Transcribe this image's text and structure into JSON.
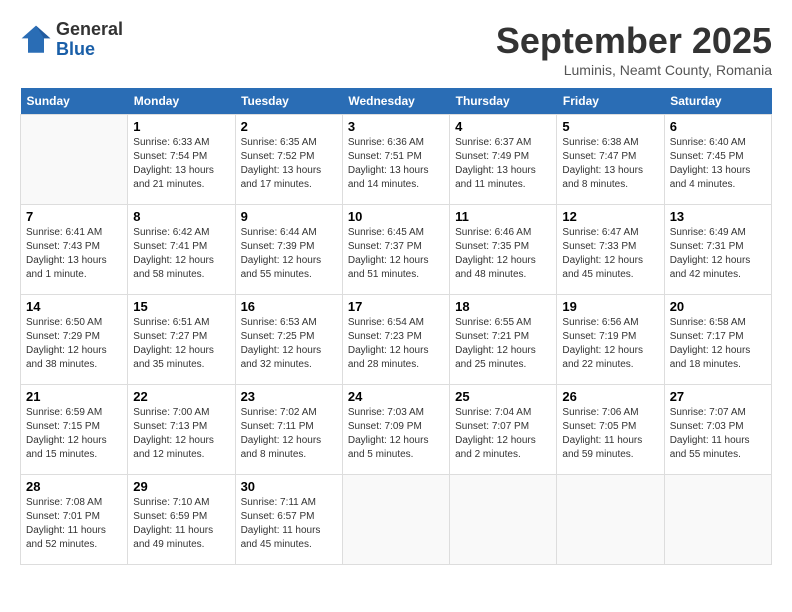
{
  "header": {
    "logo_general": "General",
    "logo_blue": "Blue",
    "month_title": "September 2025",
    "subtitle": "Luminis, Neamt County, Romania"
  },
  "days_of_week": [
    "Sunday",
    "Monday",
    "Tuesday",
    "Wednesday",
    "Thursday",
    "Friday",
    "Saturday"
  ],
  "weeks": [
    [
      {
        "day": "",
        "info": ""
      },
      {
        "day": "1",
        "info": "Sunrise: 6:33 AM\nSunset: 7:54 PM\nDaylight: 13 hours\nand 21 minutes."
      },
      {
        "day": "2",
        "info": "Sunrise: 6:35 AM\nSunset: 7:52 PM\nDaylight: 13 hours\nand 17 minutes."
      },
      {
        "day": "3",
        "info": "Sunrise: 6:36 AM\nSunset: 7:51 PM\nDaylight: 13 hours\nand 14 minutes."
      },
      {
        "day": "4",
        "info": "Sunrise: 6:37 AM\nSunset: 7:49 PM\nDaylight: 13 hours\nand 11 minutes."
      },
      {
        "day": "5",
        "info": "Sunrise: 6:38 AM\nSunset: 7:47 PM\nDaylight: 13 hours\nand 8 minutes."
      },
      {
        "day": "6",
        "info": "Sunrise: 6:40 AM\nSunset: 7:45 PM\nDaylight: 13 hours\nand 4 minutes."
      }
    ],
    [
      {
        "day": "7",
        "info": "Sunrise: 6:41 AM\nSunset: 7:43 PM\nDaylight: 13 hours\nand 1 minute."
      },
      {
        "day": "8",
        "info": "Sunrise: 6:42 AM\nSunset: 7:41 PM\nDaylight: 12 hours\nand 58 minutes."
      },
      {
        "day": "9",
        "info": "Sunrise: 6:44 AM\nSunset: 7:39 PM\nDaylight: 12 hours\nand 55 minutes."
      },
      {
        "day": "10",
        "info": "Sunrise: 6:45 AM\nSunset: 7:37 PM\nDaylight: 12 hours\nand 51 minutes."
      },
      {
        "day": "11",
        "info": "Sunrise: 6:46 AM\nSunset: 7:35 PM\nDaylight: 12 hours\nand 48 minutes."
      },
      {
        "day": "12",
        "info": "Sunrise: 6:47 AM\nSunset: 7:33 PM\nDaylight: 12 hours\nand 45 minutes."
      },
      {
        "day": "13",
        "info": "Sunrise: 6:49 AM\nSunset: 7:31 PM\nDaylight: 12 hours\nand 42 minutes."
      }
    ],
    [
      {
        "day": "14",
        "info": "Sunrise: 6:50 AM\nSunset: 7:29 PM\nDaylight: 12 hours\nand 38 minutes."
      },
      {
        "day": "15",
        "info": "Sunrise: 6:51 AM\nSunset: 7:27 PM\nDaylight: 12 hours\nand 35 minutes."
      },
      {
        "day": "16",
        "info": "Sunrise: 6:53 AM\nSunset: 7:25 PM\nDaylight: 12 hours\nand 32 minutes."
      },
      {
        "day": "17",
        "info": "Sunrise: 6:54 AM\nSunset: 7:23 PM\nDaylight: 12 hours\nand 28 minutes."
      },
      {
        "day": "18",
        "info": "Sunrise: 6:55 AM\nSunset: 7:21 PM\nDaylight: 12 hours\nand 25 minutes."
      },
      {
        "day": "19",
        "info": "Sunrise: 6:56 AM\nSunset: 7:19 PM\nDaylight: 12 hours\nand 22 minutes."
      },
      {
        "day": "20",
        "info": "Sunrise: 6:58 AM\nSunset: 7:17 PM\nDaylight: 12 hours\nand 18 minutes."
      }
    ],
    [
      {
        "day": "21",
        "info": "Sunrise: 6:59 AM\nSunset: 7:15 PM\nDaylight: 12 hours\nand 15 minutes."
      },
      {
        "day": "22",
        "info": "Sunrise: 7:00 AM\nSunset: 7:13 PM\nDaylight: 12 hours\nand 12 minutes."
      },
      {
        "day": "23",
        "info": "Sunrise: 7:02 AM\nSunset: 7:11 PM\nDaylight: 12 hours\nand 8 minutes."
      },
      {
        "day": "24",
        "info": "Sunrise: 7:03 AM\nSunset: 7:09 PM\nDaylight: 12 hours\nand 5 minutes."
      },
      {
        "day": "25",
        "info": "Sunrise: 7:04 AM\nSunset: 7:07 PM\nDaylight: 12 hours\nand 2 minutes."
      },
      {
        "day": "26",
        "info": "Sunrise: 7:06 AM\nSunset: 7:05 PM\nDaylight: 11 hours\nand 59 minutes."
      },
      {
        "day": "27",
        "info": "Sunrise: 7:07 AM\nSunset: 7:03 PM\nDaylight: 11 hours\nand 55 minutes."
      }
    ],
    [
      {
        "day": "28",
        "info": "Sunrise: 7:08 AM\nSunset: 7:01 PM\nDaylight: 11 hours\nand 52 minutes."
      },
      {
        "day": "29",
        "info": "Sunrise: 7:10 AM\nSunset: 6:59 PM\nDaylight: 11 hours\nand 49 minutes."
      },
      {
        "day": "30",
        "info": "Sunrise: 7:11 AM\nSunset: 6:57 PM\nDaylight: 11 hours\nand 45 minutes."
      },
      {
        "day": "",
        "info": ""
      },
      {
        "day": "",
        "info": ""
      },
      {
        "day": "",
        "info": ""
      },
      {
        "day": "",
        "info": ""
      }
    ]
  ]
}
